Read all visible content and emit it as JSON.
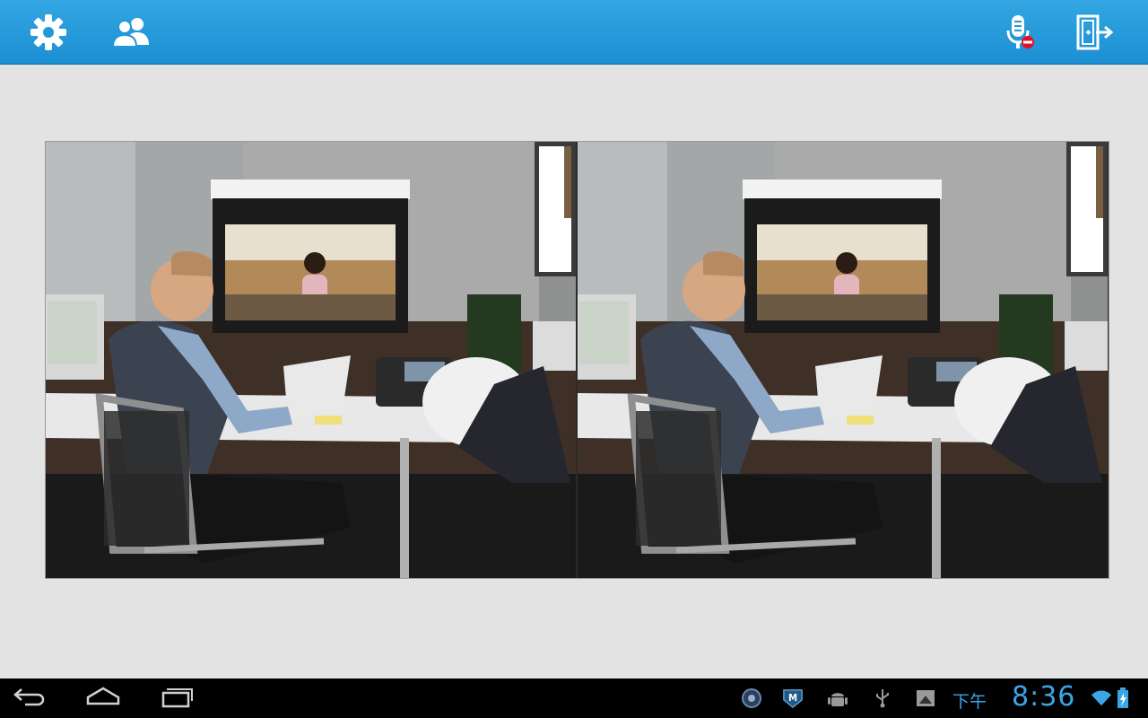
{
  "topbar": {
    "settings_icon": "gear-icon",
    "contacts_icon": "people-icon",
    "mic_icon": "microphone-muted-icon",
    "leave_icon": "exit-call-icon",
    "accent_color": "#1b8fd3"
  },
  "video": {
    "left_pane": "self-view",
    "right_pane": "remote-view"
  },
  "system_bar": {
    "ampm": "下午",
    "time": "8:36",
    "status_icons": [
      "shield-app-icon",
      "m-app-icon",
      "android-debug-icon",
      "usb-icon",
      "screenshot-icon",
      "wifi-icon",
      "battery-charging-icon"
    ],
    "accent_color": "#3aa6e8"
  }
}
